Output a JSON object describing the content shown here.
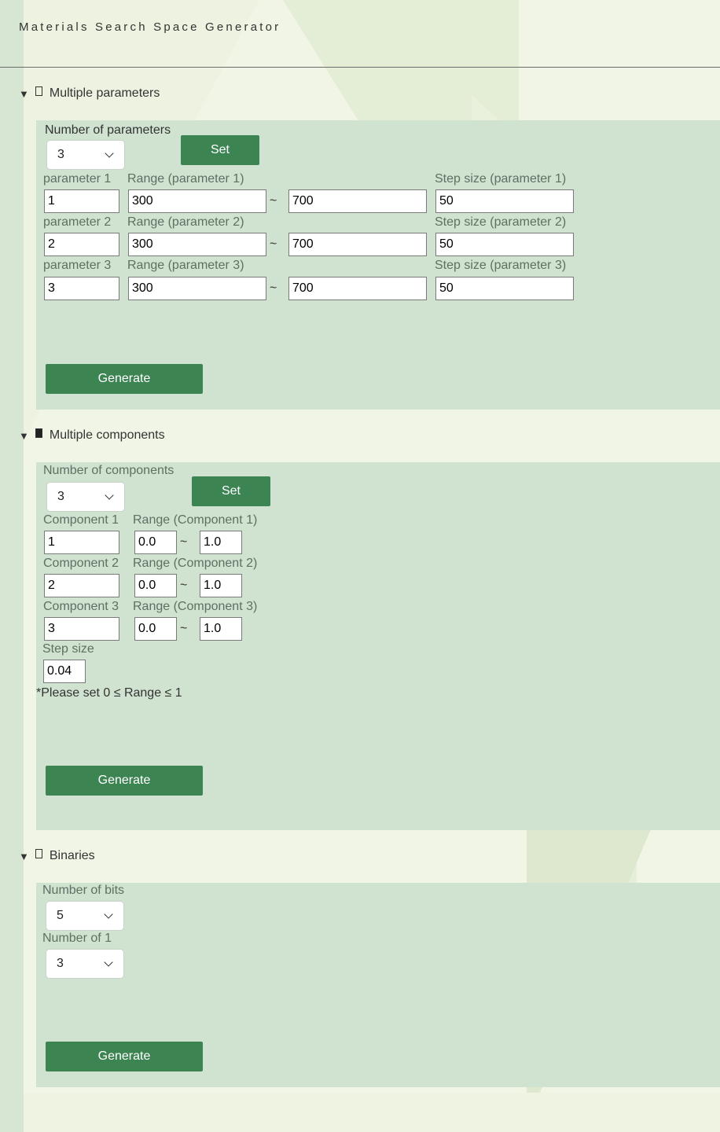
{
  "app": {
    "title": "Materials Search Space Generator"
  },
  "sections": {
    "params": {
      "summary": "Multiple parameters",
      "count_label": "Number of parameters",
      "count_value": "3",
      "set_label": "Set",
      "rows": [
        {
          "name_label": "parameter 1",
          "range_label": "Range (parameter 1)",
          "step_label": "Step size (parameter 1)",
          "name": "1",
          "min": "300",
          "max": "700",
          "step": "50"
        },
        {
          "name_label": "parameter 2",
          "range_label": "Range (parameter 2)",
          "step_label": "Step size (parameter 2)",
          "name": "2",
          "min": "300",
          "max": "700",
          "step": "50"
        },
        {
          "name_label": "parameter 3",
          "range_label": "Range (parameter 3)",
          "step_label": "Step size (parameter 3)",
          "name": "3",
          "min": "300",
          "max": "700",
          "step": "50"
        }
      ],
      "generate_label": "Generate"
    },
    "components": {
      "summary": "Multiple components",
      "count_label": "Number of components",
      "count_value": "3",
      "set_label": "Set",
      "rows": [
        {
          "name_label": "Component 1",
          "range_label": "Range (Component 1)",
          "name": "1",
          "min": "0.0",
          "max": "1.0"
        },
        {
          "name_label": "Component 2",
          "range_label": "Range (Component 2)",
          "name": "2",
          "min": "0.0",
          "max": "1.0"
        },
        {
          "name_label": "Component 3",
          "range_label": "Range (Component 3)",
          "name": "3",
          "min": "0.0",
          "max": "1.0"
        }
      ],
      "step_label": "Step size",
      "step_value": "0.04",
      "note": "*Please set 0 ≤ Range ≤ 1",
      "generate_label": "Generate"
    },
    "binaries": {
      "summary": "Binaries",
      "bits_label": "Number of bits",
      "bits_value": "5",
      "ones_label": "Number of 1",
      "ones_value": "3",
      "generate_label": "Generate"
    }
  },
  "symbols": {
    "tilde": "~",
    "disclosure": "▼"
  },
  "icons": {
    "disclosure": "triangle-down-icon",
    "doc": "document-icon",
    "chevron": "chevron-down-icon"
  },
  "colors": {
    "panel": "#cfe3d0",
    "button": "#3d8453",
    "page": "#f1f5e6"
  }
}
